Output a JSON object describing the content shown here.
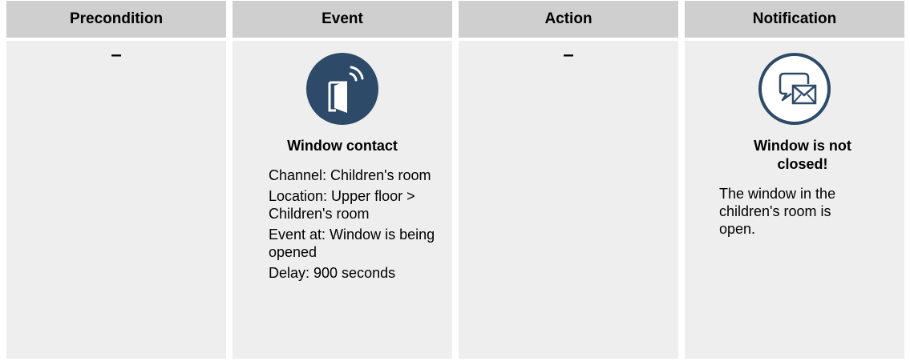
{
  "headers": {
    "precondition": "Precondition",
    "event": "Event",
    "action": "Action",
    "notification": "Notification"
  },
  "precondition": {
    "value": "–"
  },
  "event": {
    "icon": "window-contact-icon",
    "title": "Window contact",
    "lines": [
      "Channel: Children's room",
      "Location: Upper floor > Children's room",
      "Event at: Window is being opened",
      "Delay: 900 seconds"
    ]
  },
  "action": {
    "value": "–"
  },
  "notification": {
    "icon": "message-icon",
    "title": "Window is not closed!",
    "text": "The window in the children's room is open."
  },
  "colors": {
    "header_bg": "#cfcfcf",
    "cell_bg": "#eeeeee",
    "icon_blue": "#2d4a68"
  }
}
